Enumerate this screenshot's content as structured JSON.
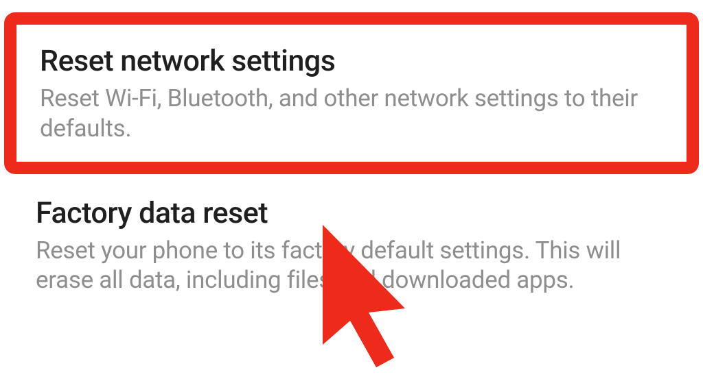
{
  "settings": {
    "items": [
      {
        "title": "Reset network settings",
        "description": "Reset Wi-Fi, Bluetooth, and other network settings to their defaults."
      },
      {
        "title": "Factory data reset",
        "description": "Reset your phone to its factory default settings. This will erase all data, including files and downloaded apps."
      }
    ]
  },
  "annotation": {
    "highlight_color": "#ee2a1a",
    "cursor_color": "#ee2a1a"
  }
}
